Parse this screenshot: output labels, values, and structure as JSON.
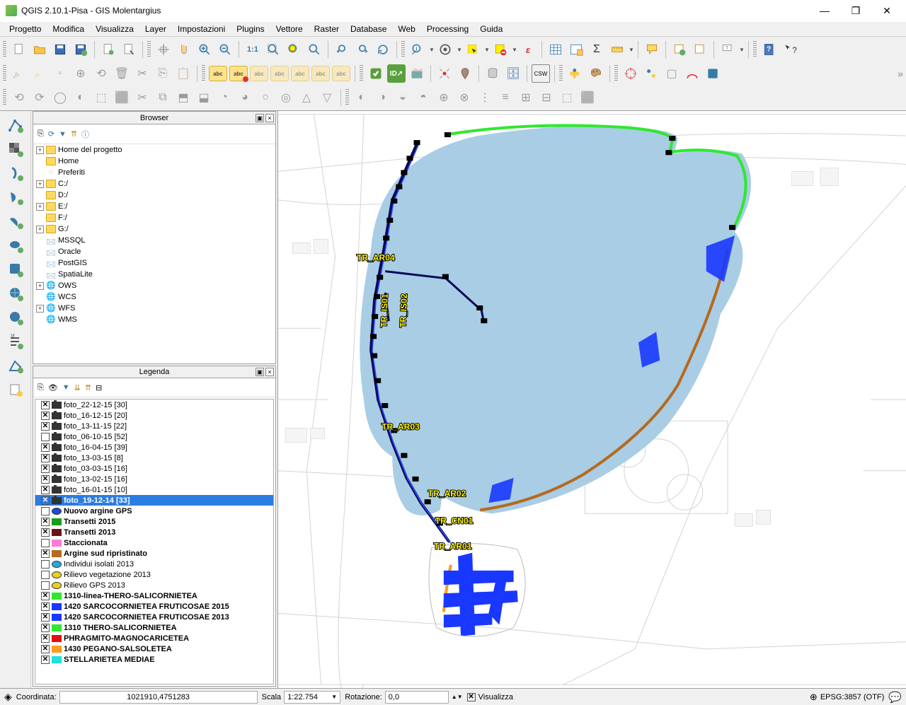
{
  "title": "QGIS 2.10.1-Pisa - GIS Molentargius",
  "menus": [
    "Progetto",
    "Modifica",
    "Visualizza",
    "Layer",
    "Impostazioni",
    "Plugins",
    "Vettore",
    "Raster",
    "Database",
    "Web",
    "Processing",
    "Guida"
  ],
  "panels": {
    "browser": {
      "title": "Browser",
      "items": [
        {
          "exp": "+",
          "type": "folder",
          "label": "Home del progetto"
        },
        {
          "exp": "",
          "type": "folder",
          "label": "Home"
        },
        {
          "exp": "",
          "type": "star",
          "label": "Preferiti"
        },
        {
          "exp": "+",
          "type": "folder",
          "label": "C:/"
        },
        {
          "exp": "",
          "type": "folder",
          "label": "D:/"
        },
        {
          "exp": "+",
          "type": "folder",
          "label": "E:/"
        },
        {
          "exp": "",
          "type": "folder",
          "label": "F:/"
        },
        {
          "exp": "+",
          "type": "folder",
          "label": "G:/"
        },
        {
          "exp": "",
          "type": "db",
          "label": "MSSQL"
        },
        {
          "exp": "",
          "type": "db",
          "label": "Oracle"
        },
        {
          "exp": "",
          "type": "db",
          "label": "PostGIS"
        },
        {
          "exp": "",
          "type": "db",
          "label": "SpatiaLite"
        },
        {
          "exp": "+",
          "type": "globe",
          "label": "OWS"
        },
        {
          "exp": "",
          "type": "globe",
          "label": "WCS"
        },
        {
          "exp": "+",
          "type": "globe",
          "label": "WFS"
        },
        {
          "exp": "",
          "type": "globe",
          "label": "WMS"
        }
      ]
    },
    "legend": {
      "title": "Legenda",
      "layers": [
        {
          "chk": "x",
          "sym": "cam",
          "label": "foto_22-12-15 [30]",
          "bold": false
        },
        {
          "chk": "x",
          "sym": "cam",
          "label": "foto_16-12-15 [20]",
          "bold": false
        },
        {
          "chk": "x",
          "sym": "cam",
          "label": "foto_13-11-15 [22]",
          "bold": false
        },
        {
          "chk": "",
          "sym": "cam",
          "label": "foto_06-10-15 [52]",
          "bold": false
        },
        {
          "chk": "x",
          "sym": "cam",
          "label": "foto_16-04-15 [39]",
          "bold": false
        },
        {
          "chk": "x",
          "sym": "cam",
          "label": "foto_13-03-15 [8]",
          "bold": false
        },
        {
          "chk": "x",
          "sym": "cam",
          "label": "foto_03-03-15 [16]",
          "bold": false
        },
        {
          "chk": "x",
          "sym": "cam",
          "label": "foto_13-02-15 [16]",
          "bold": false
        },
        {
          "chk": "x",
          "sym": "cam",
          "label": "foto_16-01-15 [10]",
          "bold": false
        },
        {
          "chk": "x",
          "sym": "cam",
          "label": "foto_19-12-14 [33]",
          "bold": true,
          "selected": true
        },
        {
          "chk": "",
          "sym": "pt-blue",
          "label": "Nuovo argine GPS",
          "bold": true
        },
        {
          "chk": "x",
          "sym": "line-green",
          "label": "Transetti 2015",
          "bold": true
        },
        {
          "chk": "x",
          "sym": "line-dred",
          "label": "Transetti 2013",
          "bold": true
        },
        {
          "chk": "",
          "sym": "line-pink",
          "label": "Staccionata",
          "bold": true
        },
        {
          "chk": "x",
          "sym": "line-brown",
          "label": "Argine sud ripristinato",
          "bold": true
        },
        {
          "chk": "",
          "sym": "pt-cyan",
          "label": "Individui isolati 2013",
          "bold": false
        },
        {
          "chk": "",
          "sym": "pt-yell",
          "label": "Rilievo vegetazione 2013",
          "bold": false
        },
        {
          "chk": "",
          "sym": "pt-yell",
          "label": "Rilievo GPS 2013",
          "bold": false
        },
        {
          "chk": "x",
          "sym": "line-lgrn",
          "label": "1310-linea-THERO-SALICORNIETEA",
          "bold": true
        },
        {
          "chk": "x",
          "sym": "sq-blue",
          "label": "1420 SARCOCORNIETEA FRUTICOSAE 2015",
          "bold": true
        },
        {
          "chk": "x",
          "sym": "sq-blue",
          "label": "1420 SARCOCORNIETEA FRUTICOSAE 2013",
          "bold": true
        },
        {
          "chk": "x",
          "sym": "sq-lgrn",
          "label": "1310 THERO-SALICORNIETEA",
          "bold": true
        },
        {
          "chk": "x",
          "sym": "sq-red",
          "label": "PHRAGMITO-MAGNOCARICETEA",
          "bold": true
        },
        {
          "chk": "x",
          "sym": "sq-org",
          "label": "1430 PEGANO-SALSOLETEA",
          "bold": true
        },
        {
          "chk": "x",
          "sym": "sq-cyan",
          "label": "STELLARIETEA MEDIAE",
          "bold": true
        }
      ]
    }
  },
  "map_labels": [
    "TR_AR04",
    "TR_IS01",
    "TR_IS02",
    "TR_AR03",
    "TR_AR02",
    "TR_CN01",
    "TR_AR01"
  ],
  "status": {
    "coord_label": "Coordinata:",
    "coord_value": "1021910,4751283",
    "scale_label": "Scala",
    "scale_value": "1:22.754",
    "rot_label": "Rotazione:",
    "rot_value": "0,0",
    "viz_label": "Visualizza",
    "crs": "EPSG:3857 (OTF)"
  }
}
